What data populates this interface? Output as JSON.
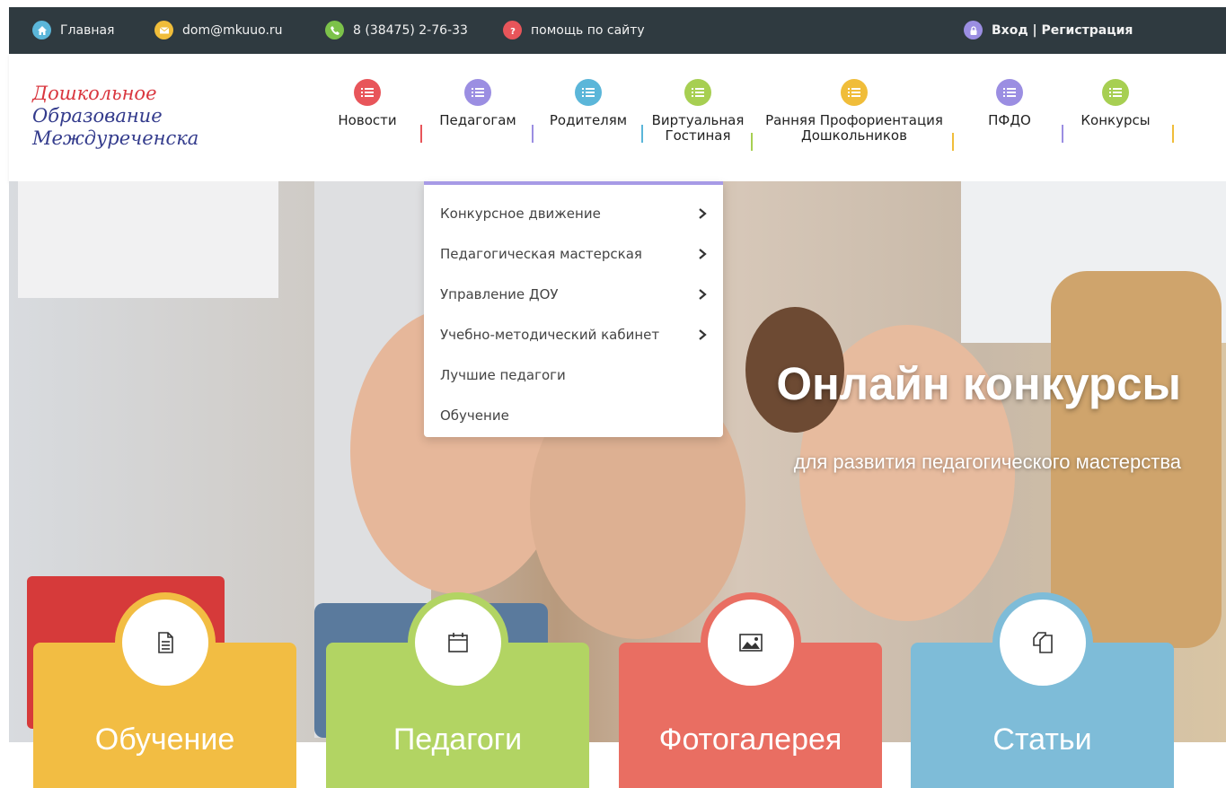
{
  "topbar": {
    "home": "Главная",
    "email": "dom@mkuuo.ru",
    "phone": "8 (38475) 2-76-33",
    "help": "помощь по сайту",
    "login": "Вход | Регистрация"
  },
  "logo": {
    "line1": "Дошкольное",
    "line2": "Образование",
    "line3": "Междуреченска"
  },
  "nav": [
    {
      "label": "Новости",
      "color": "#e8555a"
    },
    {
      "label": "Педагогам",
      "color": "#9b8ee2"
    },
    {
      "label": "Родителям",
      "color": "#5bb6d9"
    },
    {
      "label": "Виртуальная\nГостиная",
      "color": "#a7cf52"
    },
    {
      "label": "Ранняя Профориентация\nДошкольников",
      "color": "#f0bd3a"
    },
    {
      "label": "ПФДО",
      "color": "#9b8ee2"
    },
    {
      "label": "Конкурсы",
      "color": "#a7cf52"
    }
  ],
  "separator_colors": [
    "#e8555a",
    "#9b8ee2",
    "#5bb6d9",
    "#a7cf52",
    "#f0bd3a",
    "#9b8ee2",
    "#f0bd3a"
  ],
  "dropdown": [
    {
      "label": "Конкурсное движение",
      "has_submenu": true
    },
    {
      "label": "Педагогическая мастерская",
      "has_submenu": true
    },
    {
      "label": "Управление ДОУ",
      "has_submenu": true
    },
    {
      "label": "Учебно-методический кабинет",
      "has_submenu": true
    },
    {
      "label": "Лучшие педагоги",
      "has_submenu": false
    },
    {
      "label": "Обучение",
      "has_submenu": false
    }
  ],
  "hero": {
    "title": "Онлайн конкурсы",
    "subtitle": "для развития педагогического мастерства"
  },
  "cards": [
    {
      "label": "Обучение",
      "color": "#f2bd43",
      "icon": "document-icon"
    },
    {
      "label": "Педагоги",
      "color": "#b2d463",
      "icon": "calendar-icon"
    },
    {
      "label": "Фотогалерея",
      "color": "#e96e62",
      "icon": "image-icon"
    },
    {
      "label": "Статьи",
      "color": "#7ebcd8",
      "icon": "copy-icon"
    }
  ]
}
